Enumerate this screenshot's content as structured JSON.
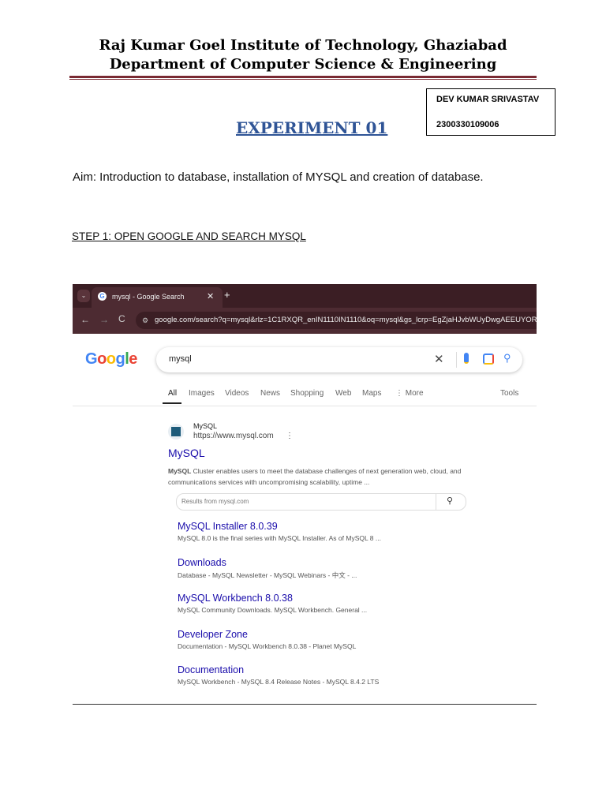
{
  "header": {
    "line1": "Raj Kumar Goel Institute of Technology, Ghaziabad",
    "line2": "Department of Computer Science & Engineering"
  },
  "student": {
    "name": "DEV KUMAR SRIVASTAV",
    "roll": "2300330109006"
  },
  "experiment_title": "EXPERIMENT 01",
  "aim": "Aim: Introduction  to database, installation of MYSQL and creation of database.",
  "step1": "STEP 1: OPEN GOOGLE AND SEARCH MYSQL",
  "browser": {
    "tab_title": "mysql - Google Search",
    "url": "google.com/search?q=mysql&rlz=1C1RXQR_enIN1110IN1110&oq=mysql&gs_lcrp=EgZjaHJvbWUyDwgAEEUYORiD",
    "logo": "Google",
    "query": "mysql",
    "nav": [
      "All",
      "Images",
      "Videos",
      "News",
      "Shopping",
      "Web",
      "Maps",
      "⋮ More"
    ],
    "tools": "Tools",
    "site_name": "MySQL",
    "site_url": "https://www.mysql.com",
    "result_title": "MySQL",
    "result_snippet_bold": "MySQL",
    "result_snippet": " Cluster enables users to meet the database challenges of next generation web, cloud, and communications services with uncompromising scalability, uptime ...",
    "site_search_placeholder": "Results from mysql.com",
    "sublinks": [
      {
        "title": "MySQL Installer 8.0.39",
        "snippet": "MySQL 8.0 is the final series with MySQL Installer. As of MySQL 8 ..."
      },
      {
        "title": "Downloads",
        "snippet": "Database - MySQL Newsletter - MySQL Webinars - 中文 - ..."
      },
      {
        "title": "MySQL Workbench 8.0.38",
        "snippet": "MySQL Community Downloads. MySQL Workbench. General ..."
      },
      {
        "title": "Developer Zone",
        "snippet": "Documentation - MySQL Workbench 8.0.38 - Planet MySQL"
      },
      {
        "title": "Documentation",
        "snippet": "MySQL Workbench - MySQL 8.4 Release Notes - MySQL 8.4.2 LTS"
      }
    ]
  }
}
